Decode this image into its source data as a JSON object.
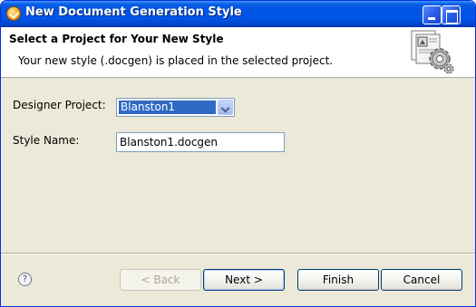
{
  "window": {
    "title": "New Document Generation Style"
  },
  "header": {
    "title": "Select a Project for Your New Style",
    "description": "Your new style (.docgen) is placed in the selected project."
  },
  "form": {
    "project_label": "Designer Project:",
    "project_value": "Blanston1",
    "style_label": "Style Name:",
    "style_value": "Blanston1.docgen"
  },
  "buttons": {
    "help": "?",
    "back": "< Back",
    "next": "Next >",
    "finish": "Finish",
    "cancel": "Cancel"
  },
  "colors": {
    "titlebar": "#0054e3",
    "dialog_bg": "#ece9d8",
    "selection": "#316ac5"
  },
  "icons": [
    "app-icon",
    "minimize-icon",
    "maximize-icon",
    "wizard-gear-icon",
    "help-icon",
    "dropdown-arrow-icon"
  ]
}
